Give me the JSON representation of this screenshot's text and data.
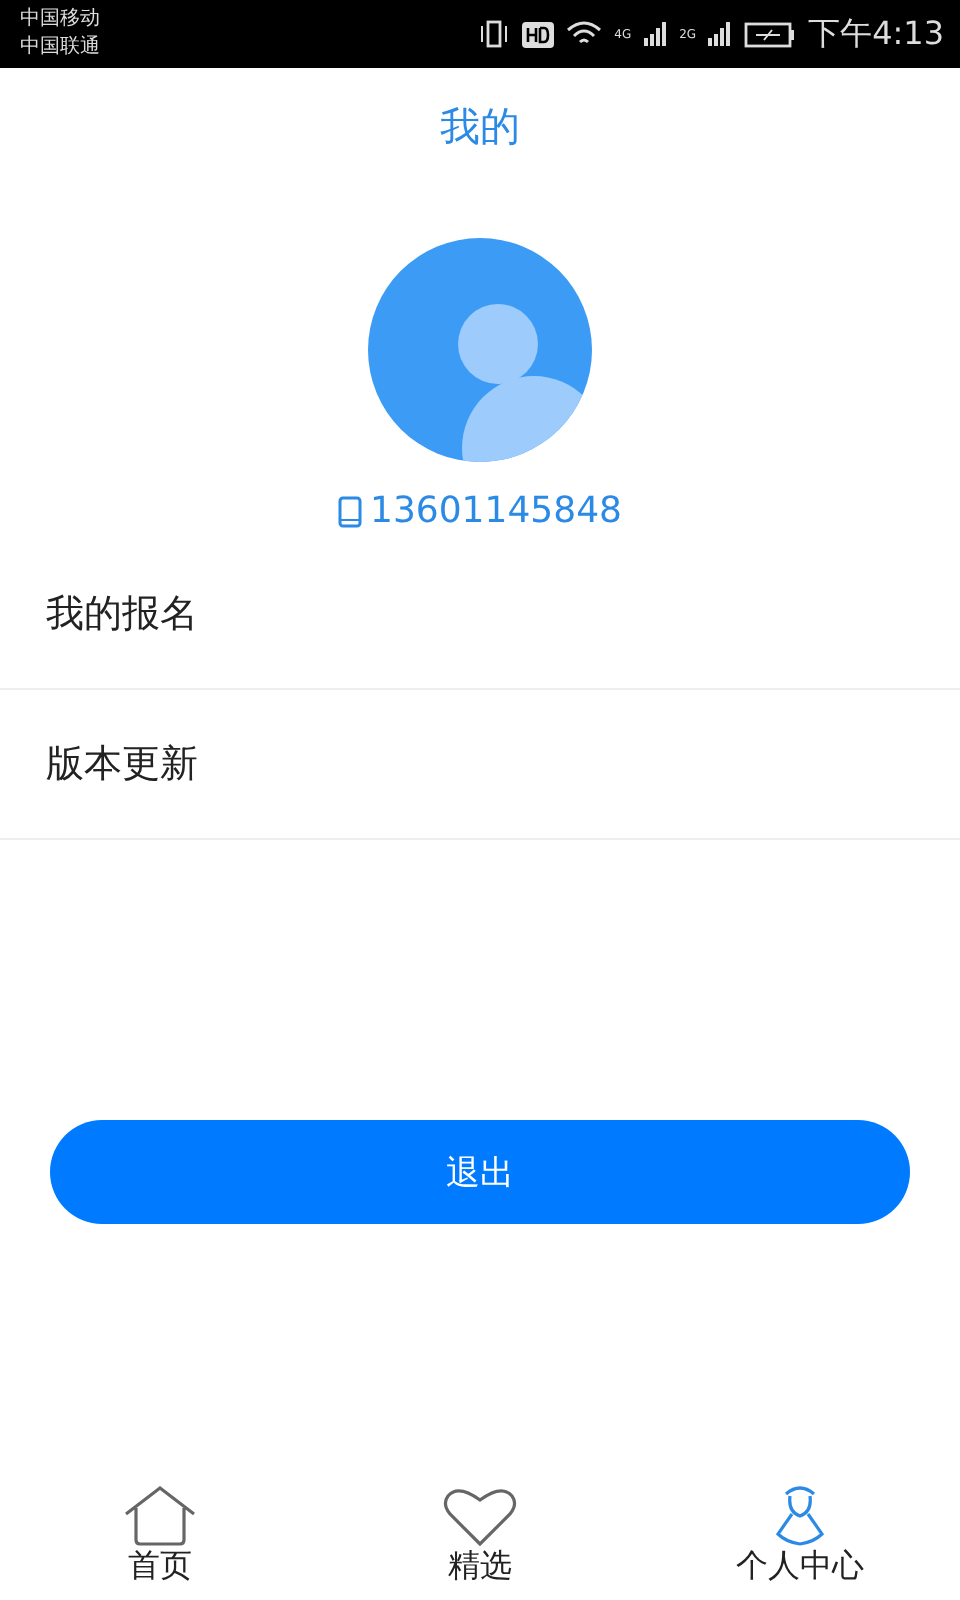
{
  "status_bar": {
    "carriers": [
      "中国移动",
      "中国联通"
    ],
    "network_labels": [
      "4G",
      "2G"
    ],
    "time": "下午4:13"
  },
  "header": {
    "title": "我的"
  },
  "profile": {
    "phone": "13601145848"
  },
  "menu": [
    {
      "label": "我的报名"
    },
    {
      "label": "版本更新"
    }
  ],
  "logout_button": {
    "label": "退出"
  },
  "tab_bar": [
    {
      "label": "首页",
      "selected": false
    },
    {
      "label": "精选",
      "selected": false
    },
    {
      "label": "个人中心",
      "selected": true
    }
  ]
}
